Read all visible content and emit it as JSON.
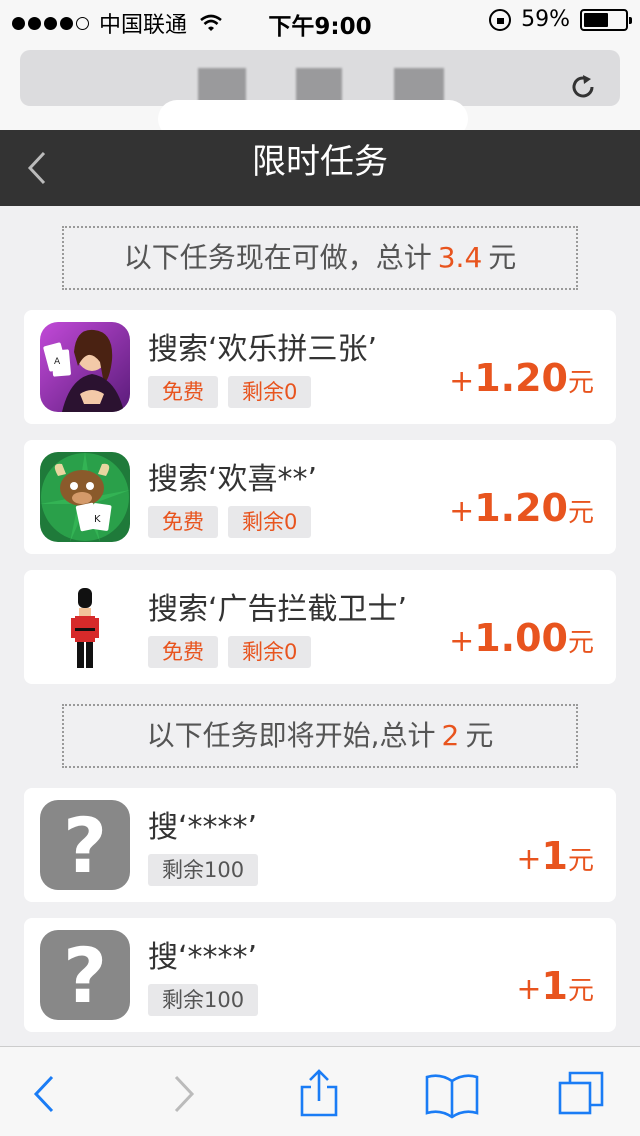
{
  "status": {
    "carrier": "中国联通",
    "time": "下午9:00",
    "battery": "59%",
    "battery_level": 0.59
  },
  "nav": {
    "title": "限时任务"
  },
  "section1": {
    "prefix": "以下任务现在可做，总计",
    "amount": "3.4",
    "suffix": "元"
  },
  "section2": {
    "prefix": "以下任务即将开始,总计",
    "amount": "2",
    "suffix": "元"
  },
  "tasks_now": [
    {
      "title": "搜索‘欢乐拼三张’",
      "tag1": "免费",
      "tag2": "剩余0",
      "plus": "+",
      "reward": "1.20",
      "unit": "元",
      "icon": "card-game-icon"
    },
    {
      "title": "搜索‘欢喜**’",
      "tag1": "免费",
      "tag2": "剩余0",
      "plus": "+",
      "reward": "1.20",
      "unit": "元",
      "icon": "bull-poker-icon"
    },
    {
      "title": "搜索‘广告拦截卫士’",
      "tag1": "免费",
      "tag2": "剩余0",
      "plus": "+",
      "reward": "1.00",
      "unit": "元",
      "icon": "guard-icon"
    }
  ],
  "tasks_soon": [
    {
      "title": "搜‘****’",
      "tag": "剩余100",
      "plus": "+",
      "reward": "1",
      "unit": "元",
      "icon": "question-icon",
      "glyph": "?"
    },
    {
      "title": "搜‘****’",
      "tag": "剩余100",
      "plus": "+",
      "reward": "1",
      "unit": "元",
      "icon": "question-icon",
      "glyph": "?"
    }
  ],
  "colors": {
    "accent": "#e8541e",
    "nav_bg": "#333333",
    "page_bg": "#f0f0f2",
    "ios_blue": "#1a7cf5"
  }
}
